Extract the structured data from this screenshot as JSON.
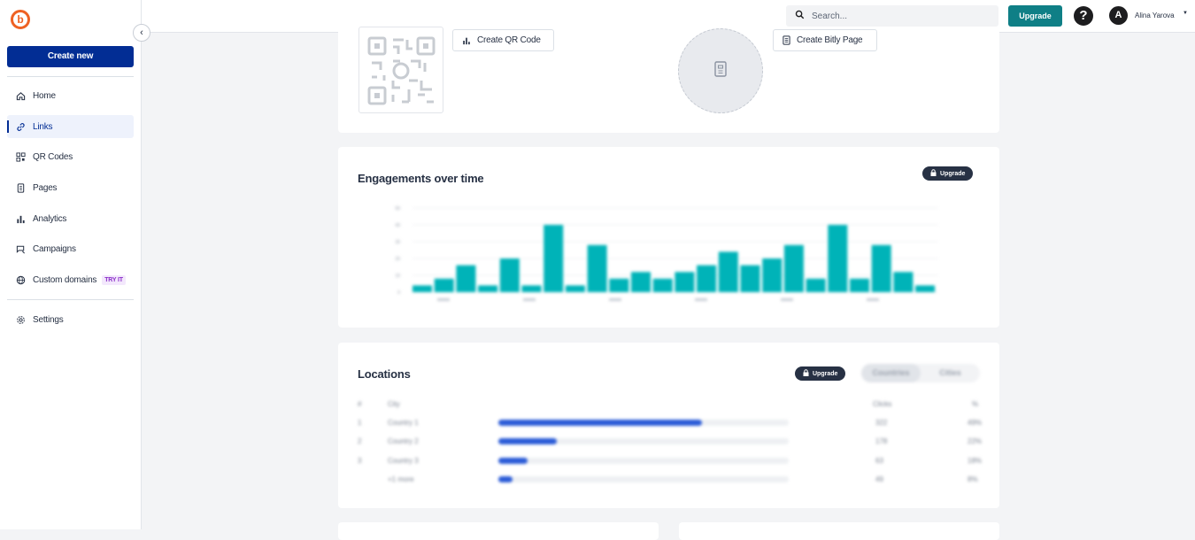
{
  "sidebar": {
    "create_label": "Create new",
    "items": [
      {
        "label": "Home",
        "icon": "home-icon",
        "active": false
      },
      {
        "label": "Links",
        "icon": "link-icon",
        "active": true
      },
      {
        "label": "QR Codes",
        "icon": "qr-code-icon",
        "active": false
      },
      {
        "label": "Pages",
        "icon": "page-icon",
        "active": false
      },
      {
        "label": "Analytics",
        "icon": "analytics-icon",
        "active": false
      },
      {
        "label": "Campaigns",
        "icon": "campaign-icon",
        "active": false
      },
      {
        "label": "Custom domains",
        "icon": "globe-icon",
        "active": false,
        "badge": "TRY IT"
      }
    ],
    "settings_label": "Settings"
  },
  "topbar": {
    "search_placeholder": "Search...",
    "upgrade_label": "Upgrade",
    "avatar_letter": "A",
    "user_name": "Alina Yarova"
  },
  "qr_card": {
    "create_qr_label": "Create QR Code",
    "create_page_label": "Create Bitly Page"
  },
  "engagements": {
    "title": "Engagements over time",
    "badge": "Upgrade"
  },
  "locations": {
    "title": "Locations",
    "badge": "Upgrade",
    "toggle": [
      "Countries",
      "Cities"
    ],
    "headers": [
      "#",
      "City",
      "Clicks",
      "%"
    ],
    "rows": [
      {
        "rank": "1",
        "name": "Country 1",
        "clicks": "322",
        "pct": "49%",
        "fill": 0.7
      },
      {
        "rank": "2",
        "name": "Country 2",
        "clicks": "178",
        "pct": "22%",
        "fill": 0.2
      },
      {
        "rank": "3",
        "name": "Country 3",
        "clicks": "63",
        "pct": "18%",
        "fill": 0.1
      },
      {
        "rank": "",
        "name": "+1 more",
        "clicks": "49",
        "pct": "8%",
        "fill": 0.05
      }
    ]
  },
  "colors": {
    "primary": "#022d94",
    "teal": "#0f7f86",
    "bars": "#00b3b8",
    "logo": "#ee6123",
    "location_bar": "#2a5bd7"
  },
  "chart_data": {
    "type": "bar",
    "title": "Engagements over time",
    "values": [
      4,
      8,
      16,
      4,
      20,
      4,
      40,
      4,
      28,
      8,
      12,
      8,
      12,
      16,
      24,
      16,
      20,
      28,
      8,
      40,
      8,
      28,
      12,
      4
    ],
    "ylim": [
      0,
      50
    ],
    "ylabel": "",
    "xlabel": ""
  }
}
